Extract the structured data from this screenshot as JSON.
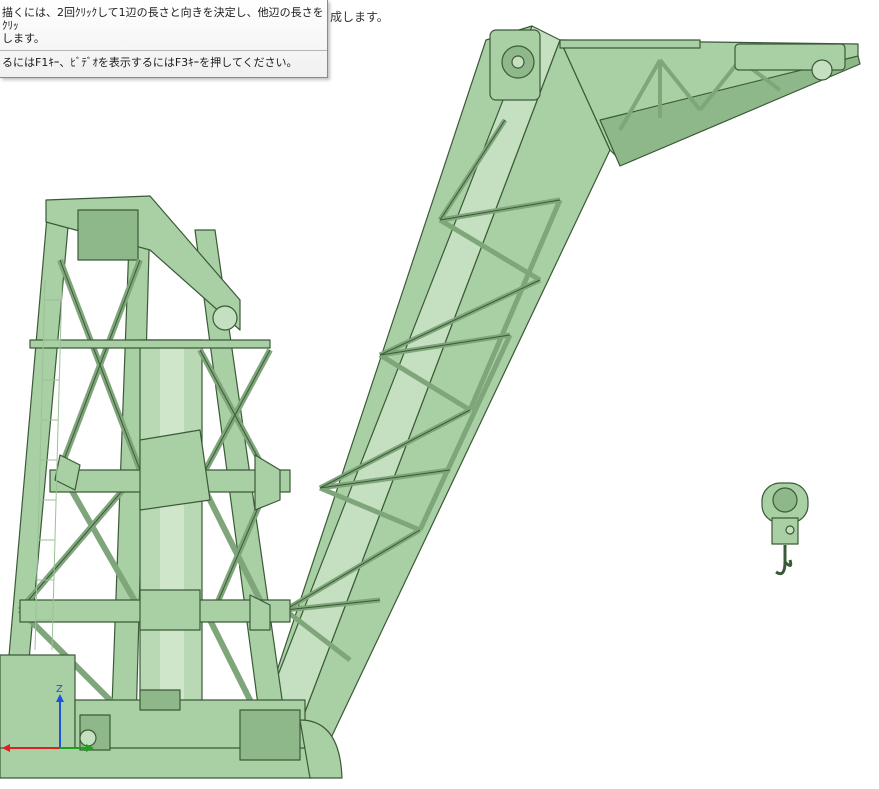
{
  "tooltip": {
    "line1": "描くには、2回ｸﾘｯｸして1辺の長さと向きを決定し、他辺の長さをｸﾘｯ",
    "line2": "します。",
    "help": "るにはF1ｷｰ、ﾋﾞﾃﾞｵを表示するにはF3ｷｰを押してください。"
  },
  "status_text": "成します。",
  "triad": {
    "z_label": "Z"
  },
  "colors": {
    "model_fill": "#a9cfa4",
    "model_edge": "#3b5a37",
    "background": "#ffffff",
    "axis_x": "#e02020",
    "axis_y": "#20a020",
    "axis_z": "#2050e0"
  }
}
